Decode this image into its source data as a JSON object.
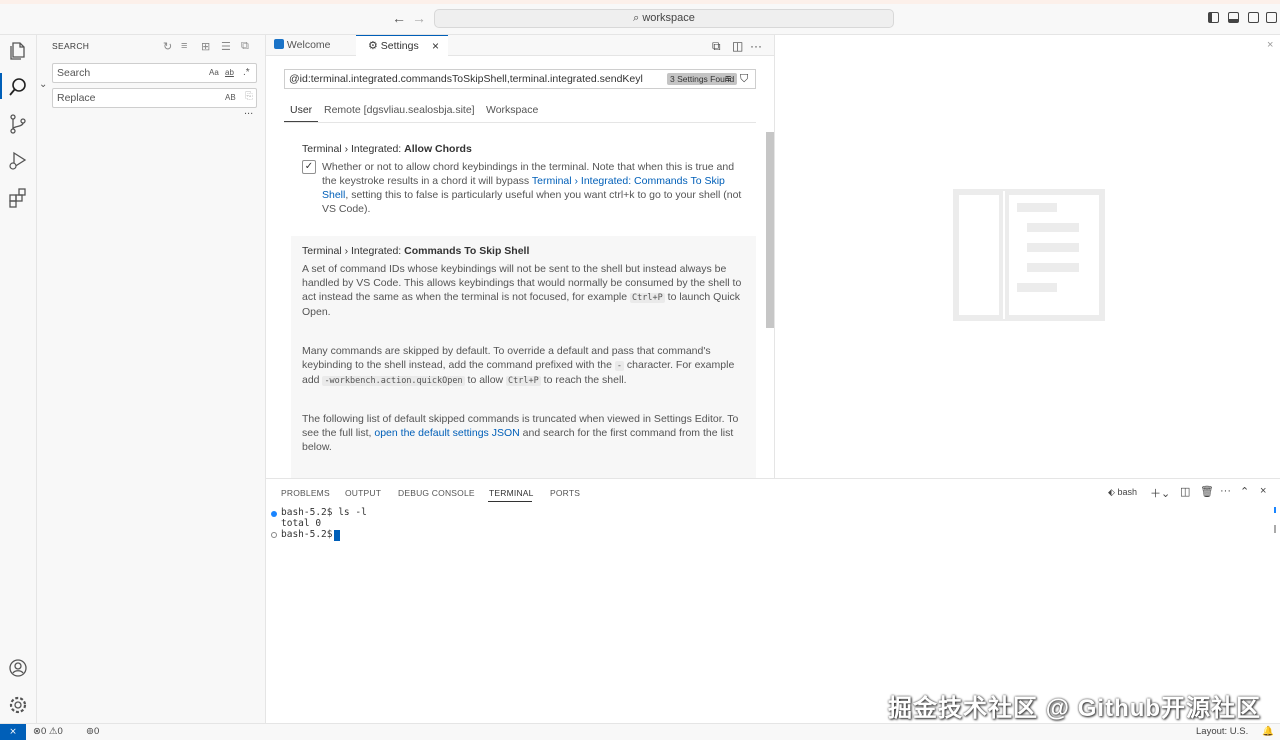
{
  "titlebar": {
    "back": "←",
    "forward": "→",
    "search_icon": "⌕",
    "workspace": "workspace"
  },
  "sidebar": {
    "title": "SEARCH",
    "search_placeholder": "Search",
    "replace_placeholder": "Replace",
    "opt_case": "Aa",
    "opt_word": "ab",
    "opt_regex": ".*",
    "opt_preserve": "AB",
    "more": "..."
  },
  "tabs": [
    {
      "label": "Welcome",
      "icon": "vscode-logo-icon"
    },
    {
      "label": "Settings",
      "icon": "settings-icon",
      "close": "×"
    }
  ],
  "settings": {
    "query": "@id:terminal.integrated.commandsToSkipShell,terminal.integrated.sendKeyl",
    "found": "3 Settings Found",
    "scopes": [
      "User",
      "Remote [dgsvliau.sealosbja.site]",
      "Workspace"
    ],
    "allow_chords": {
      "prefix": "Terminal › Integrated: ",
      "name": "Allow Chords",
      "desc_a": "Whether or not to allow chord keybindings in the terminal. Note that when this is true and the keystroke results in a chord it will bypass ",
      "desc_link": "Terminal › Integrated: Commands To Skip Shell",
      "desc_b": ", setting this to false is particularly useful when you want ctrl+k to go to your shell (not VS Code).",
      "checked": "✓"
    },
    "skip_shell": {
      "prefix": "Terminal › Integrated: ",
      "name": "Commands To Skip Shell",
      "p1_a": "A set of command IDs whose keybindings will not be sent to the shell but instead always be handled by VS Code. This allows keybindings that would normally be consumed by the shell to act instead the same as when the terminal is not focused, for example ",
      "p1_code": "Ctrl+P",
      "p1_b": " to launch Quick Open.",
      "p2_a": "Many commands are skipped by default. To override a default and pass that command's keybinding to the shell instead, add the command prefixed with the ",
      "p2_code1": "-",
      "p2_b": " character. For example add ",
      "p2_code2": "-workbench.action.quickOpen",
      "p2_c": " to allow ",
      "p2_code3": "Ctrl+P",
      "p2_d": " to reach the shell.",
      "p3_a": "The following list of default skipped commands is truncated when viewed in Settings Editor. To see the full list, ",
      "p3_link": "open the default settings JSON",
      "p3_b": " and search for the first command from the list below."
    }
  },
  "panel": {
    "tabs": [
      "PROBLEMS",
      "OUTPUT",
      "DEBUG CONSOLE",
      "TERMINAL",
      "PORTS"
    ],
    "shell": "bash",
    "terminal_lines": [
      "bash-5.2$ ls -l",
      "total 0",
      "bash-5.2$ "
    ]
  },
  "statusbar": {
    "errors": "0",
    "warnings": "0",
    "ports": "0",
    "layout": "Layout: U.S."
  },
  "watermark": "掘金技术社区 @ Github开源社区",
  "colors": {
    "accent": "#005fb8",
    "link": "#005fb8"
  }
}
